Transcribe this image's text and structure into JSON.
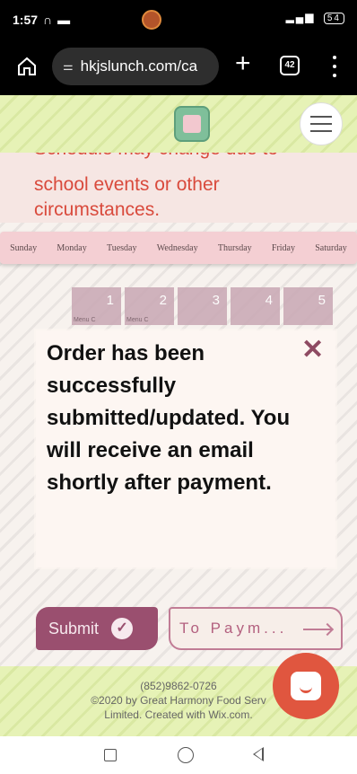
{
  "status_bar": {
    "time": "1:57",
    "battery": "54"
  },
  "browser": {
    "url": "hkjslunch.com/ca",
    "tab_count": "42"
  },
  "notice": {
    "cut_line": "Schedule may change due to",
    "text": "school events or other circumstances."
  },
  "weekdays": [
    "Sunday",
    "Monday",
    "Tuesday",
    "Wednesday",
    "Thursday",
    "Friday",
    "Saturday"
  ],
  "calendar": {
    "days": [
      {
        "num": "1",
        "tag": "Menu C"
      },
      {
        "num": "2",
        "tag": "Menu C"
      },
      {
        "num": "3",
        "tag": ""
      },
      {
        "num": "4",
        "tag": ""
      },
      {
        "num": "5",
        "tag": ""
      }
    ]
  },
  "modal": {
    "message": "Order has been successfully submitted/updated. You will receive an email shortly after payment.",
    "close_glyph": "✕"
  },
  "actions": {
    "submit_label": "Submit",
    "payment_label": "To Paym..."
  },
  "footer": {
    "phone": "(852)9862-0726",
    "copyright": "©2020 by Great Harmony Food Serv",
    "credit": "Limited. Created with Wix.com."
  },
  "icons": {
    "home": "home-icon",
    "tune": "tune-icon",
    "plus": "plus-icon",
    "menu": "more-vert-icon",
    "chat": "chat-icon"
  },
  "colors": {
    "accent": "#9a4f6f",
    "notice_text": "#d94a3c",
    "header_bg": "#e6f2b6",
    "chat": "#e0563f"
  }
}
